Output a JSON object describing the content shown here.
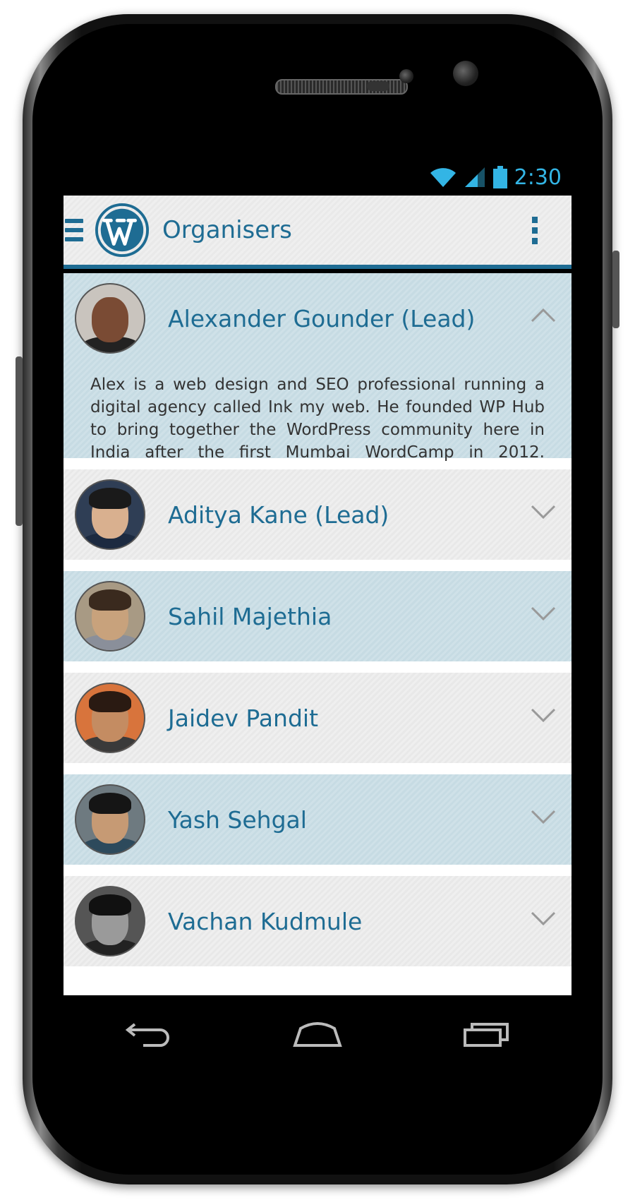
{
  "status_bar": {
    "time": "2:30",
    "wifi_icon": "wifi-icon",
    "signal_icon": "signal-icon",
    "battery_icon": "battery-icon",
    "color": "#33b5e5"
  },
  "action_bar": {
    "menu_icon": "hamburger-menu-icon",
    "logo": "wordpress-logo",
    "title": "Organisers",
    "overflow_icon": "overflow-menu-icon",
    "accent_color": "#1e6c93"
  },
  "organisers": [
    {
      "name": "Alexander Gounder (Lead)",
      "expanded": true,
      "bio": "Alex is a web design and SEO professional running a digital agency called Ink my web. He founded WP Hub to bring together the WordPress community here in India after the first Mumbai WordCamp in 2012.",
      "chevron_icon": "chevron-up-icon"
    },
    {
      "name": "Aditya Kane (Lead)",
      "expanded": false,
      "chevron_icon": "chevron-down-icon"
    },
    {
      "name": "Sahil Majethia",
      "expanded": false,
      "chevron_icon": "chevron-down-icon"
    },
    {
      "name": "Jaidev Pandit",
      "expanded": false,
      "chevron_icon": "chevron-down-icon"
    },
    {
      "name": "Yash Sehgal",
      "expanded": false,
      "chevron_icon": "chevron-down-icon"
    },
    {
      "name": "Vachan Kudmule",
      "expanded": false,
      "chevron_icon": "chevron-down-icon"
    }
  ],
  "nav_bar": {
    "back_icon": "back-icon",
    "home_icon": "home-icon",
    "recents_icon": "recent-apps-icon"
  }
}
